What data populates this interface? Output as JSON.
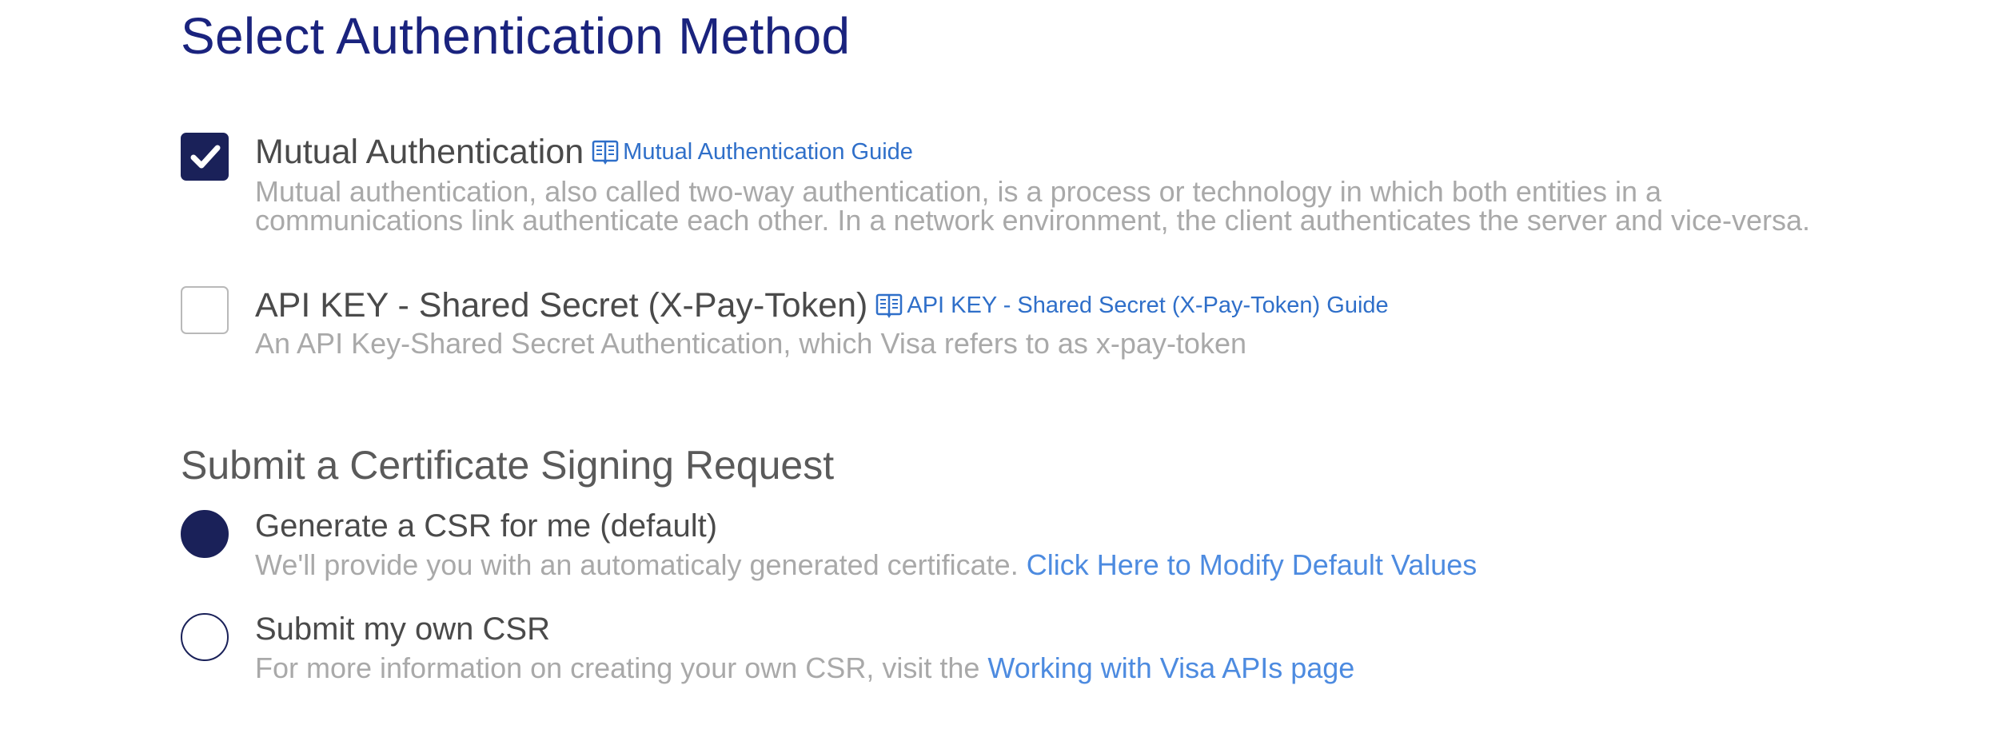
{
  "page_title": "Select Authentication Method",
  "auth_options": [
    {
      "title": "Mutual Authentication",
      "guide_link": "Mutual Authentication Guide",
      "description_line1": "Mutual authentication, also called two-way authentication, is a process or technology in which both entities in a",
      "description_line2": "communications link authenticate each other. In a network environment, the client authenticates the server and vice-versa.",
      "checked": true
    },
    {
      "title": "API KEY - Shared Secret (X-Pay-Token)",
      "guide_link": "API KEY - Shared Secret (X-Pay-Token) Guide",
      "description": "An API Key-Shared Secret Authentication, which Visa refers to as x-pay-token",
      "checked": false
    }
  ],
  "csr_section": {
    "title": "Submit a Certificate Signing Request",
    "options": [
      {
        "title": "Generate a CSR for me (default)",
        "description": "We'll provide you with an automaticaly generated certificate.",
        "link": "Click Here to Modify Default Values",
        "selected": true
      },
      {
        "title": "Submit my own CSR",
        "description": "For more information on creating your own CSR, visit the",
        "link": "Working with Visa APIs page",
        "selected": false
      }
    ]
  },
  "colors": {
    "title": "#1a237e",
    "control_fill": "#1a2159",
    "guide_link": "#2f6fc9",
    "inline_link": "#4d8be0",
    "muted_text": "#a9a9a9"
  },
  "icons": {
    "check": "checkmark-icon",
    "guide": "book-icon"
  }
}
